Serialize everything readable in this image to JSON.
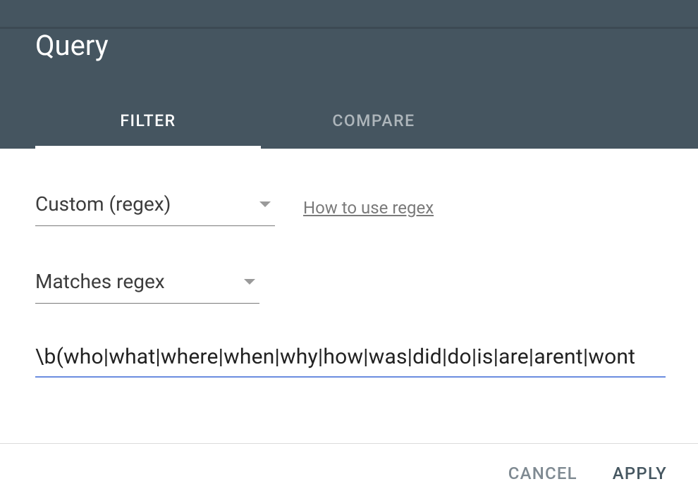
{
  "header": {
    "title": "Query",
    "tabs": {
      "filter": "FILTER",
      "compare": "COMPARE"
    }
  },
  "filter": {
    "type_select": "Custom (regex)",
    "help_link": "How to use regex",
    "match_select": "Matches regex",
    "regex_value": "\\b(who|what|where|when|why|how|was|did|do|is|are|arent|wont"
  },
  "footer": {
    "cancel": "CANCEL",
    "apply": "APPLY"
  }
}
